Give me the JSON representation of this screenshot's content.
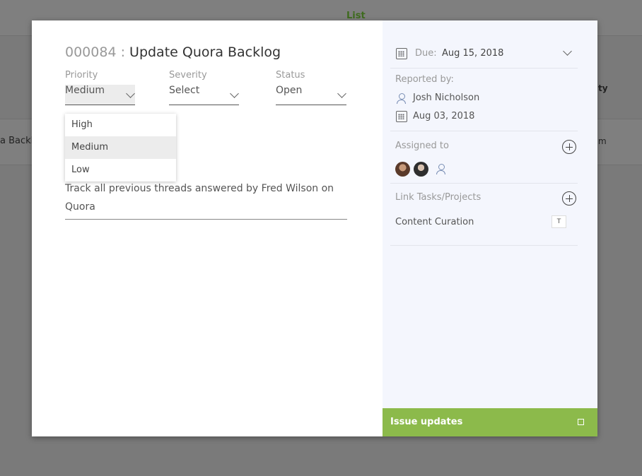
{
  "background": {
    "tab_label": "List",
    "row_text_left": "a Backl",
    "col_header_right": "ty",
    "row_text_right": "m"
  },
  "issue": {
    "number": "000084 :",
    "title": "Update Quora Backlog",
    "priority": {
      "label": "Priority",
      "value": "Medium"
    },
    "severity": {
      "label": "Severity",
      "value": "Select"
    },
    "status": {
      "label": "Status",
      "value": "Open"
    },
    "priority_options": [
      "High",
      "Medium",
      "Low"
    ],
    "priority_selected": "Medium",
    "description": "Track all previous threads answered by Fred Wilson on Quora"
  },
  "sidebar": {
    "due_label": "Due:",
    "due_value": "Aug 15, 2018",
    "reported_by_label": "Reported by:",
    "reporter_name": "Josh Nicholson",
    "reported_date": "Aug 03, 2018",
    "assigned_to_label": "Assigned to",
    "link_label": "Link Tasks/Projects",
    "linked_task": "Content Curation",
    "linked_task_type": "T",
    "updates_label": "Issue updates"
  },
  "colors": {
    "accent_green": "#8cba4b",
    "sidebar_bg": "#f4f6fd",
    "overlay": "#7a7a7a"
  },
  "icons": [
    "calendar-icon",
    "chevron-down-icon",
    "person-icon",
    "plus-circle-icon",
    "checkbox-icon"
  ]
}
